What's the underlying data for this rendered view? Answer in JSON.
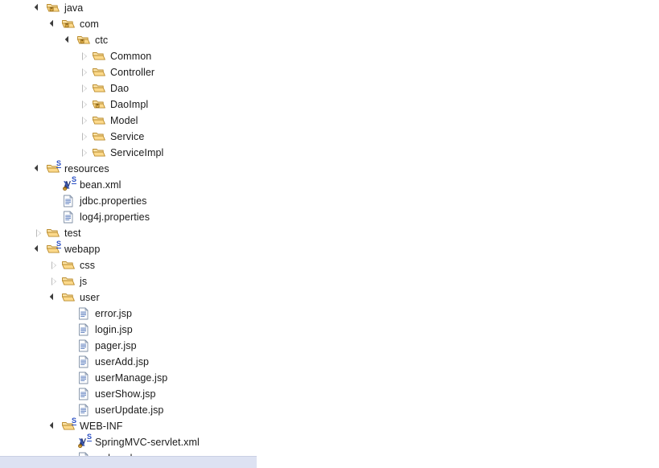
{
  "view": {
    "name": "project-explorer",
    "background_color": "#ffffff",
    "text_color": "#1a1a1a",
    "selection_bar_color": "#dde2f2",
    "folder_color": "#f4c05a",
    "badge_color": "#2a4fc4"
  },
  "tree": {
    "nodes": [
      {
        "label": "java",
        "depth": 0,
        "state": "expanded",
        "icon": "package-folder-icon",
        "badge": ""
      },
      {
        "label": "com",
        "depth": 1,
        "state": "expanded",
        "icon": "package-folder-icon",
        "badge": ""
      },
      {
        "label": "ctc",
        "depth": 2,
        "state": "expanded",
        "icon": "package-folder-icon",
        "badge": ""
      },
      {
        "label": "Common",
        "depth": 3,
        "state": "collapsed",
        "icon": "folder-icon",
        "badge": ""
      },
      {
        "label": "Controller",
        "depth": 3,
        "state": "collapsed",
        "icon": "folder-icon",
        "badge": ""
      },
      {
        "label": "Dao",
        "depth": 3,
        "state": "collapsed",
        "icon": "folder-icon",
        "badge": ""
      },
      {
        "label": "DaoImpl",
        "depth": 3,
        "state": "collapsed",
        "icon": "package-folder-icon",
        "badge": ""
      },
      {
        "label": "Model",
        "depth": 3,
        "state": "collapsed",
        "icon": "folder-icon",
        "badge": ""
      },
      {
        "label": "Service",
        "depth": 3,
        "state": "collapsed",
        "icon": "folder-icon",
        "badge": ""
      },
      {
        "label": "ServiceImpl",
        "depth": 3,
        "state": "collapsed",
        "icon": "folder-icon",
        "badge": ""
      },
      {
        "label": "resources",
        "depth": 0,
        "state": "expanded",
        "icon": "source-folder-icon",
        "badge": "S"
      },
      {
        "label": "bean.xml",
        "depth": 1,
        "state": "leaf",
        "icon": "spring-bean-xml-icon",
        "badge": "S"
      },
      {
        "label": "jdbc.properties",
        "depth": 1,
        "state": "leaf",
        "icon": "file-icon",
        "badge": ""
      },
      {
        "label": "log4j.properties",
        "depth": 1,
        "state": "leaf",
        "icon": "file-icon",
        "badge": ""
      },
      {
        "label": "test",
        "depth": 0,
        "state": "collapsed",
        "icon": "folder-icon",
        "badge": ""
      },
      {
        "label": "webapp",
        "depth": 0,
        "state": "expanded",
        "icon": "source-folder-icon",
        "badge": "S"
      },
      {
        "label": "css",
        "depth": 1,
        "state": "collapsed",
        "icon": "folder-icon",
        "badge": ""
      },
      {
        "label": "js",
        "depth": 1,
        "state": "collapsed",
        "icon": "folder-icon",
        "badge": ""
      },
      {
        "label": "user",
        "depth": 1,
        "state": "expanded",
        "icon": "folder-icon",
        "badge": ""
      },
      {
        "label": "error.jsp",
        "depth": 2,
        "state": "leaf",
        "icon": "file-icon",
        "badge": ""
      },
      {
        "label": "login.jsp",
        "depth": 2,
        "state": "leaf",
        "icon": "file-icon",
        "badge": ""
      },
      {
        "label": "pager.jsp",
        "depth": 2,
        "state": "leaf",
        "icon": "file-icon",
        "badge": ""
      },
      {
        "label": "userAdd.jsp",
        "depth": 2,
        "state": "leaf",
        "icon": "file-icon",
        "badge": ""
      },
      {
        "label": "userManage.jsp",
        "depth": 2,
        "state": "leaf",
        "icon": "file-icon",
        "badge": ""
      },
      {
        "label": "userShow.jsp",
        "depth": 2,
        "state": "leaf",
        "icon": "file-icon",
        "badge": ""
      },
      {
        "label": "userUpdate.jsp",
        "depth": 2,
        "state": "leaf",
        "icon": "file-icon",
        "badge": ""
      },
      {
        "label": "WEB-INF",
        "depth": 1,
        "state": "expanded",
        "icon": "source-folder-icon",
        "badge": "S"
      },
      {
        "label": "SpringMVC-servlet.xml",
        "depth": 2,
        "state": "leaf",
        "icon": "spring-bean-xml-icon",
        "badge": "S"
      }
    ],
    "clipped_node": {
      "label": "web.xml",
      "depth": 2,
      "state": "leaf",
      "icon": "file-icon",
      "badge": ""
    }
  }
}
